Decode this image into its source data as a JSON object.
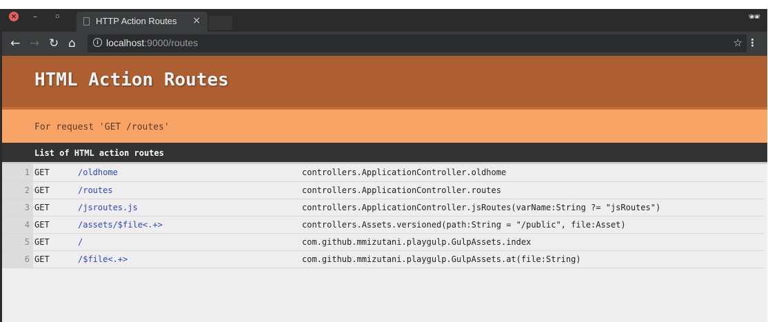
{
  "browser": {
    "tab_title": "HTTP Action Routes",
    "tab_close": "×",
    "url_host": "localhost",
    "url_rest": ":9000/routes"
  },
  "page": {
    "title": "HTML Action Routes",
    "subtitle": "For request 'GET /routes'",
    "list_heading": "List of HTML action routes",
    "routes": [
      {
        "num": "1",
        "verb": "GET",
        "path": "/oldhome",
        "action": "controllers.ApplicationController.oldhome"
      },
      {
        "num": "2",
        "verb": "GET",
        "path": "/routes",
        "action": "controllers.ApplicationController.routes"
      },
      {
        "num": "3",
        "verb": "GET",
        "path": "/jsroutes.js",
        "action": "controllers.ApplicationController.jsRoutes(varName:String ?= \"jsRoutes\")"
      },
      {
        "num": "4",
        "verb": "GET",
        "path": "/assets/$file<.+>",
        "action": "controllers.Assets.versioned(path:String = \"/public\", file:Asset)"
      },
      {
        "num": "5",
        "verb": "GET",
        "path": "/",
        "action": "com.github.mmizutani.playgulp.GulpAssets.index"
      },
      {
        "num": "6",
        "verb": "GET",
        "path": "/$file<.+>",
        "action": "com.github.mmizutani.playgulp.GulpAssets.at(file:String)"
      }
    ]
  },
  "colors": {
    "header_bg": "#ae5f32",
    "subheader_bg": "#f9a467",
    "list_header_bg": "#333333",
    "link": "#2d45c8"
  }
}
